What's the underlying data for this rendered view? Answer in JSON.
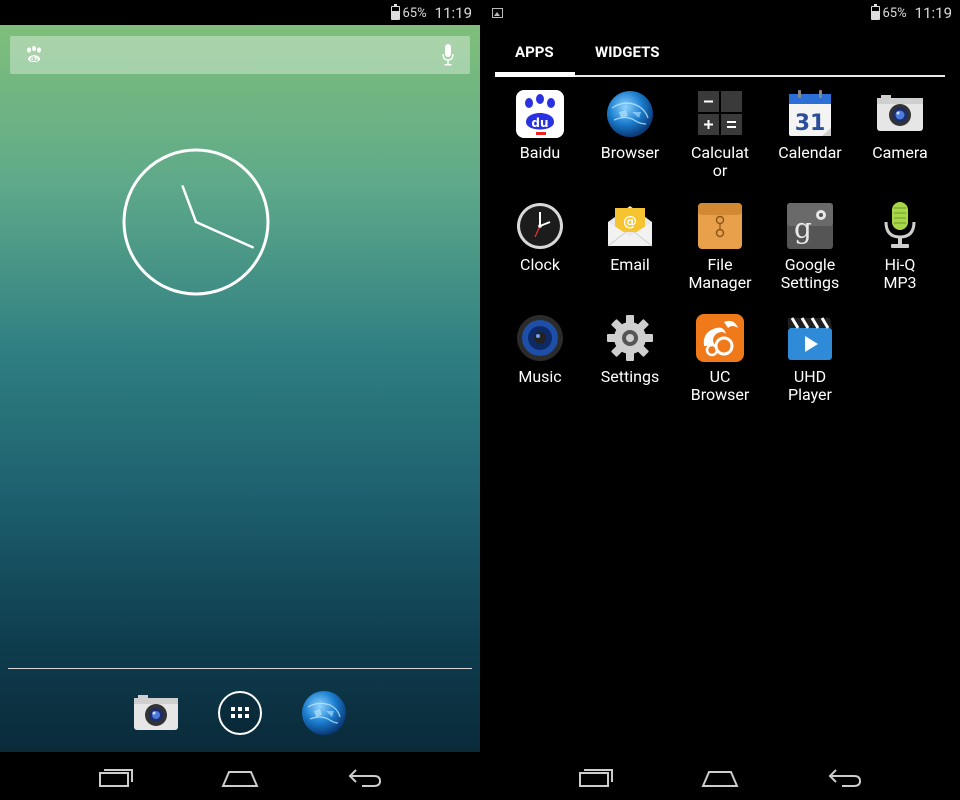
{
  "status_bar": {
    "battery_pct": "65%",
    "battery_level": 0.65,
    "time": "11:19"
  },
  "home": {
    "search_icon": "baidu-paw-icon",
    "mic_icon": "mic-icon",
    "clock_widget": {
      "hour": 11,
      "minute": 19
    },
    "dock": [
      {
        "name": "camera",
        "icon": "camera-icon"
      },
      {
        "name": "all-apps",
        "icon": "app-grid-icon"
      },
      {
        "name": "browser",
        "icon": "globe-icon"
      }
    ]
  },
  "drawer": {
    "tabs": [
      {
        "label": "APPS",
        "selected": true
      },
      {
        "label": "WIDGETS",
        "selected": false
      }
    ],
    "apps": [
      {
        "label": "Baidu",
        "icon": "baidu-icon"
      },
      {
        "label": "Browser",
        "icon": "globe-icon"
      },
      {
        "label": "Calculat\nor",
        "icon": "calculator-icon"
      },
      {
        "label": "Calendar",
        "icon": "calendar-icon",
        "day": "31"
      },
      {
        "label": "Camera",
        "icon": "camera-icon"
      },
      {
        "label": "Clock",
        "icon": "clock-icon"
      },
      {
        "label": "Email",
        "icon": "email-icon"
      },
      {
        "label": "File\nManager",
        "icon": "folder-icon"
      },
      {
        "label": "Google\nSettings",
        "icon": "google-settings-icon"
      },
      {
        "label": "Hi-Q\nMP3",
        "icon": "microphone-icon"
      },
      {
        "label": "Music",
        "icon": "speaker-icon"
      },
      {
        "label": "Settings",
        "icon": "gear-icon"
      },
      {
        "label": "UC\nBrowser",
        "icon": "uc-squirrel-icon"
      },
      {
        "label": "UHD\nPlayer",
        "icon": "clapperboard-icon"
      }
    ]
  },
  "nav": {
    "recent_icon": "recent-apps-icon",
    "home_icon": "home-icon",
    "back_icon": "back-icon"
  },
  "colors": {
    "wallpaper_top": "#7fbf7a",
    "wallpaper_bottom": "#0a2a3a",
    "tab_indicator": "#ffffff",
    "baidu_blue": "#2932e1",
    "uc_orange": "#f07a1a"
  }
}
